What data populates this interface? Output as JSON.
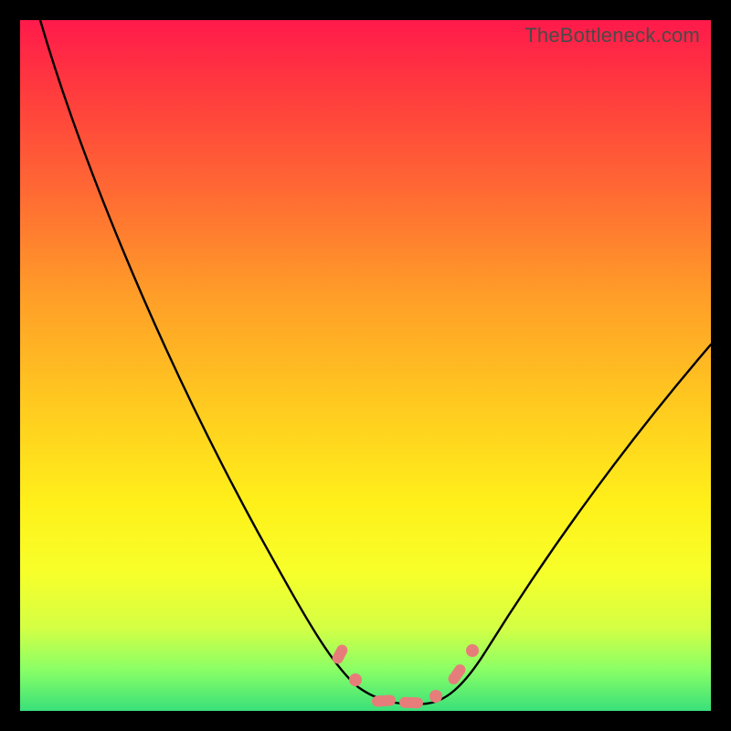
{
  "watermark": "TheBottleneck.com",
  "chart_data": {
    "type": "line",
    "title": "",
    "xlabel": "",
    "ylabel": "",
    "xlim": [
      0,
      100
    ],
    "ylim": [
      0,
      100
    ],
    "grid": false,
    "series": [
      {
        "name": "curve",
        "x": [
          3,
          6,
          10,
          15,
          20,
          25,
          30,
          35,
          40,
          45,
          48,
          50,
          52,
          55,
          58,
          60,
          62,
          65,
          70,
          75,
          80,
          85,
          90,
          95,
          100
        ],
        "y": [
          100,
          92,
          83,
          72,
          62,
          52,
          42,
          32,
          22,
          12,
          7,
          4,
          2,
          1,
          1,
          1,
          2,
          5,
          12,
          20,
          28,
          35,
          42,
          48,
          53
        ]
      }
    ],
    "markers": [
      {
        "shape": "pill",
        "x": 46.5,
        "y": 8,
        "angle": -70
      },
      {
        "shape": "circle",
        "x": 49,
        "y": 4
      },
      {
        "shape": "pill",
        "x": 53,
        "y": 1.2,
        "angle": 0
      },
      {
        "shape": "pill",
        "x": 57,
        "y": 1.0,
        "angle": 0
      },
      {
        "shape": "circle",
        "x": 60.5,
        "y": 2
      },
      {
        "shape": "pill",
        "x": 63,
        "y": 5.5,
        "angle": 55
      },
      {
        "shape": "circle",
        "x": 65.5,
        "y": 9
      }
    ],
    "marker_color": "#e77d7a"
  }
}
